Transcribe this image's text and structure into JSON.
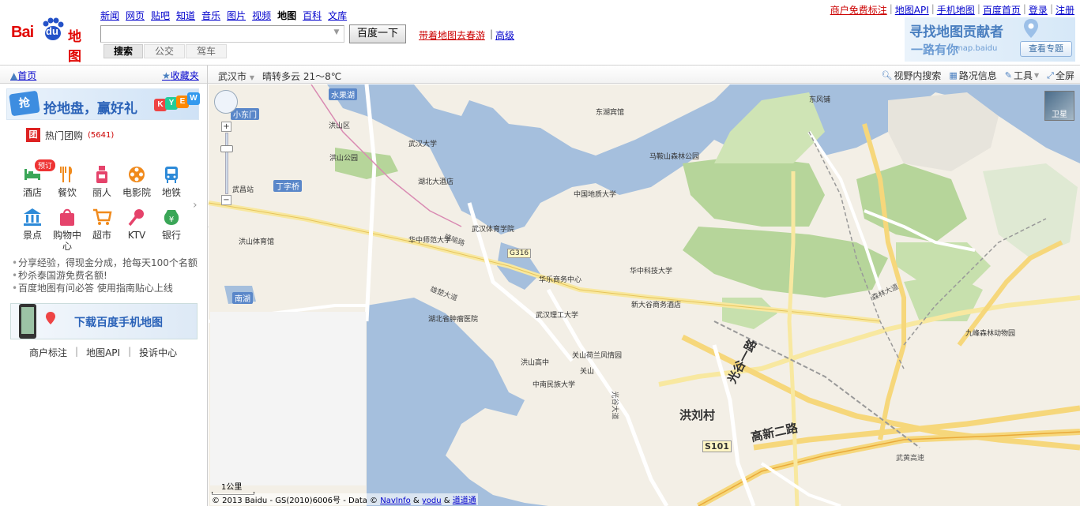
{
  "logo": {
    "bai": "Bai",
    "du": "du",
    "map": "地图"
  },
  "nav": {
    "items": [
      "新闻",
      "网页",
      "贴吧",
      "知道",
      "音乐",
      "图片",
      "视频",
      "地图",
      "百科",
      "文库"
    ],
    "current": "地图"
  },
  "search": {
    "value": "",
    "button": "百度一下",
    "promo": "带着地图去春游",
    "separator": "|",
    "advanced": "高级"
  },
  "modes": [
    "搜索",
    "公交",
    "驾车"
  ],
  "toplinks": [
    "商户免费标注",
    "地图API",
    "手机地图",
    "百度首页",
    "登录",
    "注册"
  ],
  "banner": {
    "title": "寻找地图贡献者",
    "sub": "一路有你",
    "site": "map.baidu",
    "button": "查看专题"
  },
  "subbar": {
    "home": "首页",
    "fav": "收藏夹",
    "city": "武汉市",
    "weather": "晴转多云 21～8℃",
    "tools": [
      "视野内搜索",
      "路况信息",
      "工具",
      "全屏"
    ]
  },
  "left": {
    "ad_badge": "抢",
    "ad_text": "抢地盘，赢好礼",
    "ad_keys": [
      "K",
      "Y",
      "E",
      "W"
    ],
    "groupon_icon": "团",
    "groupon_label": "热门团购",
    "groupon_count": "(5641)",
    "tag": "预订",
    "categories": [
      {
        "label": "酒店",
        "icon": "hotel-icon",
        "color": "#3aa657"
      },
      {
        "label": "餐饮",
        "icon": "restaurant-icon",
        "color": "#f08a1c"
      },
      {
        "label": "丽人",
        "icon": "beauty-icon",
        "color": "#e5436b"
      },
      {
        "label": "电影院",
        "icon": "cinema-icon",
        "color": "#f08a1c"
      },
      {
        "label": "地铁",
        "icon": "subway-icon",
        "color": "#2d8ad8"
      },
      {
        "label": "景点",
        "icon": "scenic-icon",
        "color": "#2d8ad8"
      },
      {
        "label": "购物中心",
        "icon": "shopping-icon",
        "color": "#e5436b"
      },
      {
        "label": "超市",
        "icon": "supermarket-icon",
        "color": "#f08a1c"
      },
      {
        "label": "KTV",
        "icon": "ktv-icon",
        "color": "#e5436b"
      },
      {
        "label": "银行",
        "icon": "bank-icon",
        "color": "#3aa657"
      }
    ],
    "tips": [
      "分享经验，得现金分成，抢每天100个名额",
      "秒杀泰国游免费名额!",
      "百度地图有问必答 使用指南贴心上线"
    ],
    "download": "下载百度手机地图",
    "footer": [
      "商户标注",
      "地图API",
      "投诉中心"
    ]
  },
  "map": {
    "satellite": "卫星",
    "scale": "1公里",
    "copyright": {
      "text": "© 2013 Baidu - GS(2010)6006号 - Data ©",
      "l1": "NavInfo",
      "amp1": "&",
      "l2": "yodu",
      "amp2": "&",
      "l3": "道道通"
    },
    "labels": [
      {
        "t": "水果湖",
        "c": "blue"
      },
      {
        "t": "小东门",
        "c": "blue"
      },
      {
        "t": "丁字桥",
        "c": "blue"
      },
      {
        "t": "南湖",
        "c": "blue"
      },
      {
        "t": "洪山区",
        "c": ""
      },
      {
        "t": "武汉大学",
        "c": ""
      },
      {
        "t": "洪山公园",
        "c": ""
      },
      {
        "t": "湖北大酒店",
        "c": ""
      },
      {
        "t": "武昌站",
        "c": ""
      },
      {
        "t": "洪山体育馆",
        "c": ""
      },
      {
        "t": "华中科技大学",
        "c": ""
      },
      {
        "t": "中国地质大学",
        "c": ""
      },
      {
        "t": "华中师范大学",
        "c": ""
      },
      {
        "t": "武汉体育学院",
        "c": ""
      },
      {
        "t": "中南民族大学",
        "c": ""
      },
      {
        "t": "新大谷商务酒店",
        "c": ""
      },
      {
        "t": "武汉理工大学",
        "c": ""
      },
      {
        "t": "关山",
        "c": ""
      },
      {
        "t": "东湖宾馆",
        "c": ""
      },
      {
        "t": "马鞍山森林公园",
        "c": ""
      },
      {
        "t": "光谷大道",
        "c": "road"
      },
      {
        "t": "珞喻路",
        "c": "road"
      },
      {
        "t": "雄楚大道",
        "c": "road"
      },
      {
        "t": "森林大道",
        "c": "road"
      },
      {
        "t": "洪刘村",
        "c": "big"
      },
      {
        "t": "高新二路",
        "c": "big"
      },
      {
        "t": "光谷一路",
        "c": "big"
      },
      {
        "t": "G316",
        "c": "hw"
      },
      {
        "t": "S101",
        "c": "hw"
      },
      {
        "t": "九峰森林动物园",
        "c": ""
      },
      {
        "t": "关山荷兰风情园",
        "c": ""
      },
      {
        "t": "华乐商务中心",
        "c": ""
      },
      {
        "t": "东风铺",
        "c": ""
      },
      {
        "t": "湖北省肿瘤医院",
        "c": ""
      },
      {
        "t": "洪山高中",
        "c": ""
      },
      {
        "t": "武黄高速",
        "c": "road"
      }
    ]
  }
}
